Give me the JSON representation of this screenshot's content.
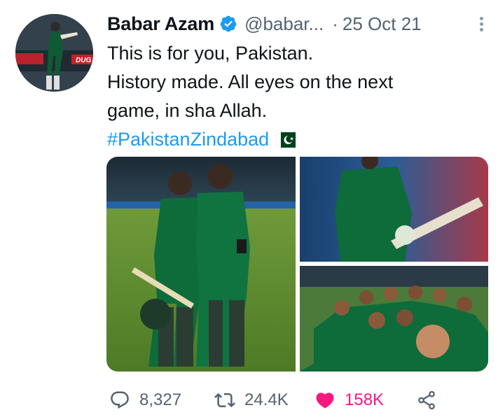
{
  "author": {
    "name": "Babar Azam",
    "handle": "@babar...",
    "verified": true
  },
  "meta": {
    "separator": "·",
    "date": "25 Oct 21"
  },
  "tweet": {
    "lines": [
      "This is for you, Pakistan.",
      "History made. All eyes on the next",
      "game, in sha Allah."
    ],
    "hashtag": "#PakistanZindabad",
    "emoji": "pakistan-flag"
  },
  "media": {
    "count": 3,
    "images": [
      "two-players-celebrating",
      "player-raising-bat",
      "team-group-selfie"
    ]
  },
  "actions": {
    "replies": "8,327",
    "retweets": "24.4K",
    "likes": "158K",
    "liked": true
  },
  "colors": {
    "text": "#0f1419",
    "secondary": "#536471",
    "link": "#1d9bf0",
    "like": "#f91880",
    "verified": "#1d9bf0",
    "jersey": "#0e6b3a"
  },
  "icons": [
    "verified-badge-icon",
    "more-icon",
    "reply-icon",
    "retweet-icon",
    "heart-icon",
    "share-icon"
  ]
}
